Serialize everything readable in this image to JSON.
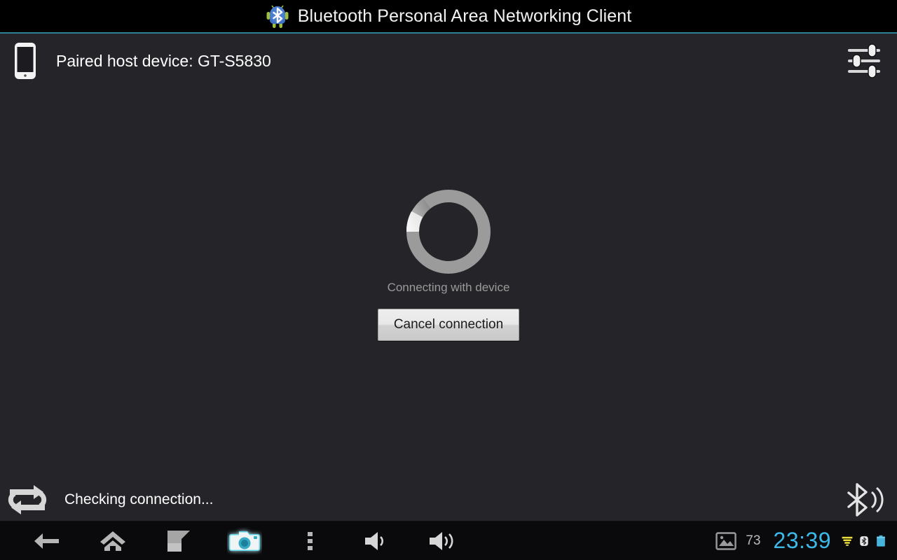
{
  "window": {
    "title": "Bluetooth Personal Area Networking Client",
    "app_icon": "bluetooth-android-icon",
    "accent_color": "#2d7f96",
    "titlebar_bg": "#000000",
    "content_bg": "#252428"
  },
  "subheader": {
    "device_icon": "phone-icon",
    "label": "Paired host device: GT-S5830",
    "settings_icon": "sliders-settings-icon"
  },
  "main": {
    "spinner_icon": "circular-progress-spinner",
    "status_text": "Connecting with device",
    "cancel_button_label": "Cancel connection"
  },
  "app_status_bar": {
    "loop_icon": "loop-refresh-icon",
    "message": "Checking connection...",
    "bluetooth_icon": "bluetooth-signal-icon"
  },
  "navbar": {
    "buttons": [
      {
        "name": "back-button",
        "icon": "back-arrow-icon"
      },
      {
        "name": "home-button",
        "icon": "home-icon"
      },
      {
        "name": "recents-button",
        "icon": "recent-apps-icon"
      },
      {
        "name": "screenshot-button",
        "icon": "camera-icon"
      },
      {
        "name": "menu-button",
        "icon": "overflow-menu-icon"
      },
      {
        "name": "volume-down-button",
        "icon": "volume-down-icon"
      },
      {
        "name": "volume-up-button",
        "icon": "volume-up-icon"
      }
    ],
    "status": {
      "screenshot_icon": "image-icon",
      "notification_count": "73",
      "clock": "23:39",
      "clock_color": "#3cb9e8",
      "wifi_icon": "wifi-icon",
      "wifi_color": "#ecdf3c",
      "bluetooth_icon": "bluetooth-icon",
      "battery_icon": "battery-icon",
      "battery_color": "#45b5dd"
    }
  }
}
